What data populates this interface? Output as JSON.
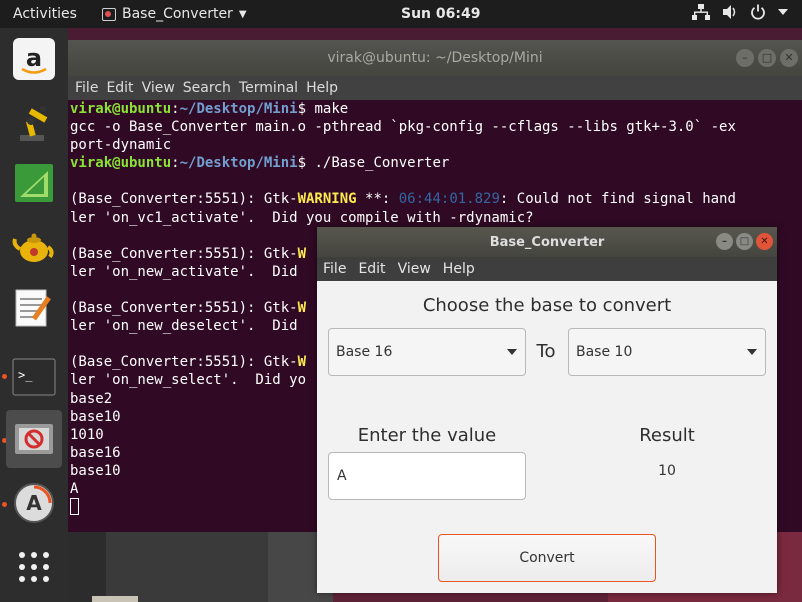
{
  "topbar": {
    "activities": "Activities",
    "app_name": "Base_Converter",
    "clock": "Sun 06:49"
  },
  "terminal": {
    "title": "virak@ubuntu: ~/Desktop/Mini",
    "menu": [
      "File",
      "Edit",
      "View",
      "Search",
      "Terminal",
      "Help"
    ],
    "prompt_user": "virak@ubuntu",
    "prompt_path": "~/Desktop/Mini",
    "cmd_make": "make",
    "gcc_line1": "gcc -o Base_Converter main.o -pthread `pkg-config --cflags --libs gtk+-3.0` -ex",
    "gcc_line2": "port-dynamic",
    "cmd_run": "./Base_Converter",
    "warn_prefix": "(Base_Converter:5551): Gtk-",
    "warn_word": "WARNING",
    "warn_sep": " **: ",
    "warn_time": "06:44:01.829",
    "warn_msg": ": Could not find signal hand",
    "warn_l2_1": "ler 'on_vc1_activate'.  Did you compile with -rdynamic?",
    "warn_partial": "(Base_Converter:5551): Gtk-",
    "warn_partial_w": "W",
    "warn_l2_2": "ler 'on_new_activate'.  Did",
    "warn_l2_3": "ler 'on_new_deselect'.  Did",
    "warn_l2_4": "ler 'on_new_select'.  Did yo",
    "out_1": "base2",
    "out_2": "base10",
    "out_3": "1010",
    "out_4": "base16",
    "out_5": "base10",
    "out_6": "A"
  },
  "app": {
    "title": "Base_Converter",
    "menu": [
      "File",
      "Edit",
      "View",
      "Help"
    ],
    "heading": "Choose the base to convert",
    "from_base": "Base 16",
    "to_label": "To",
    "to_base": "Base 10",
    "enter_label": "Enter the value",
    "input_value": "A",
    "result_label": "Result",
    "result_value": "10",
    "convert_label": "Convert"
  }
}
